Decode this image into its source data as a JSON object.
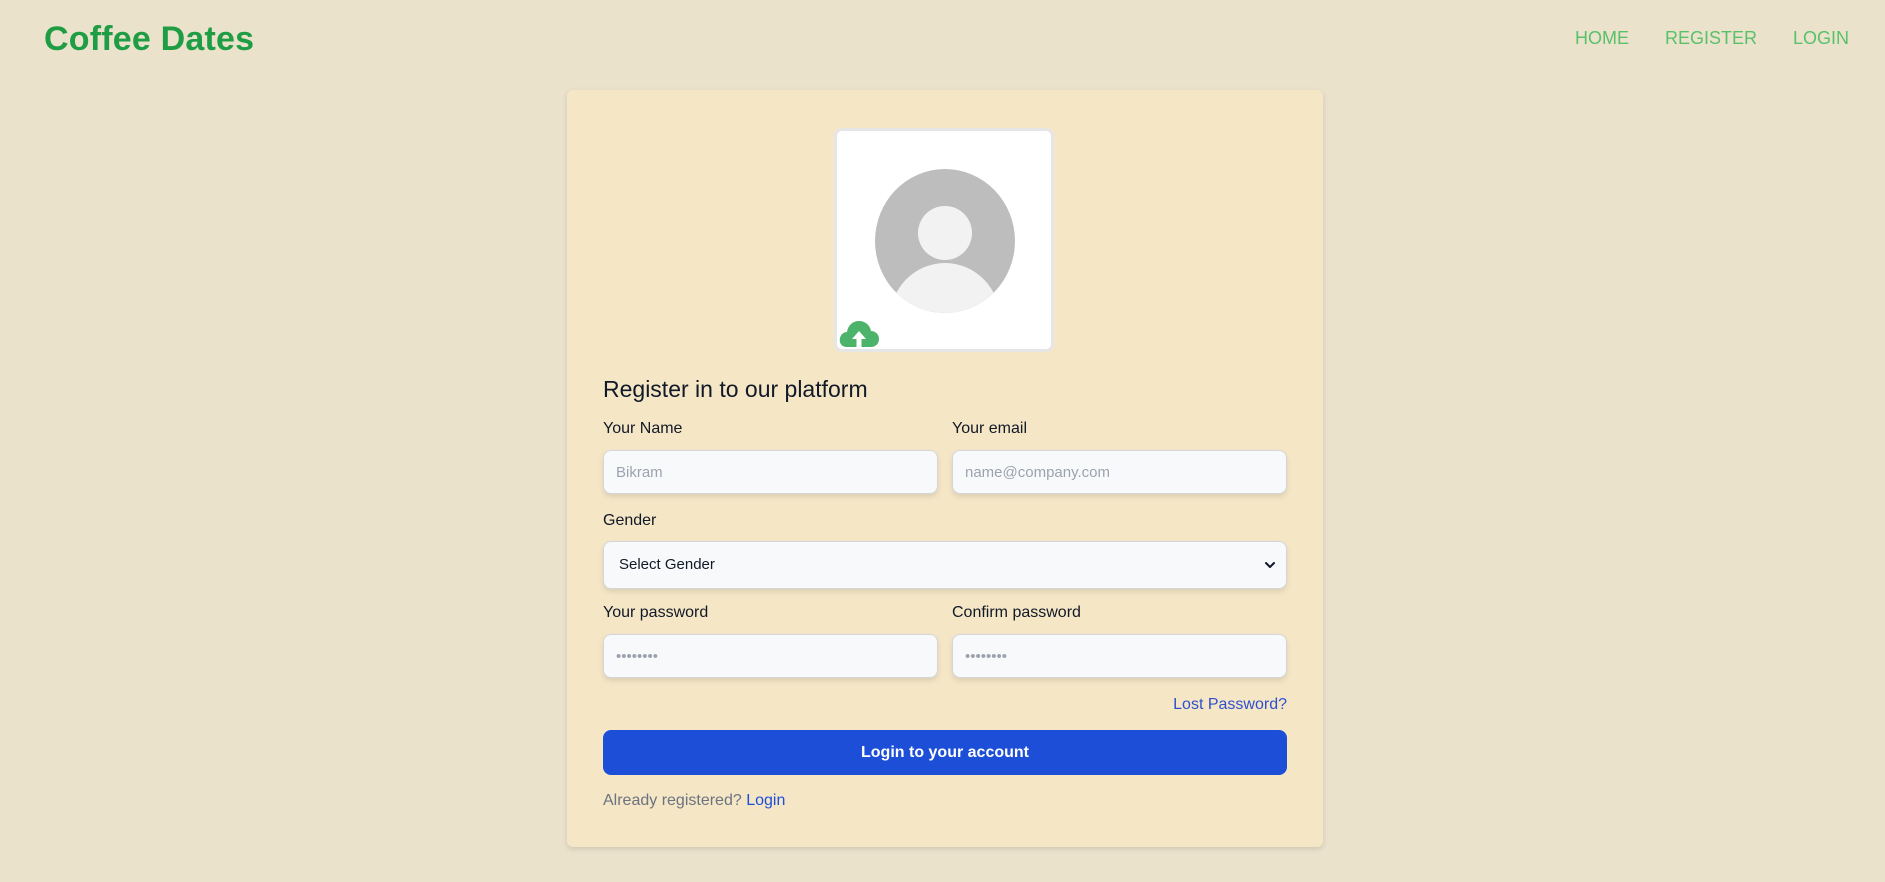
{
  "header": {
    "brand": "Coffee Dates",
    "nav": [
      {
        "label": "HOME"
      },
      {
        "label": "REGISTER"
      },
      {
        "label": "LOGIN"
      }
    ]
  },
  "avatar": {
    "image_icon": "default-avatar-icon",
    "upload_icon": "cloud-upload-icon"
  },
  "form": {
    "title": "Register in to our platform",
    "name_label": "Your Name",
    "name_placeholder": "Bikram",
    "email_label": "Your email",
    "email_placeholder": "name@company.com",
    "gender_label": "Gender",
    "gender_selected": "Select Gender",
    "password_label": "Your password",
    "password_placeholder": "••••••••",
    "confirm_label": "Confirm password",
    "confirm_placeholder": "••••••••",
    "lost_password": "Lost Password?",
    "submit_label": "Login to your account",
    "already_text": "Already registered?",
    "login_link": "Login"
  },
  "colors": {
    "background": "#ebe2cc",
    "card": "#f5e7c6",
    "brand": "#1f9d45",
    "nav": "#58c16a",
    "primary_button": "#1d4ed8",
    "link": "#2f4fcf",
    "upload_icon": "#4cb36a"
  }
}
